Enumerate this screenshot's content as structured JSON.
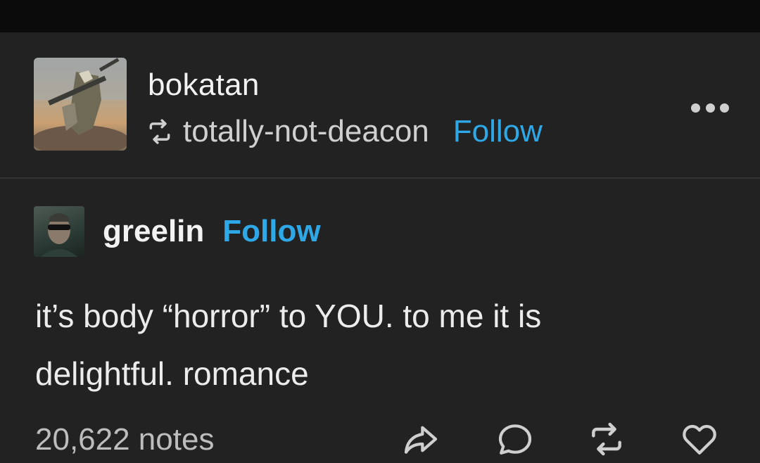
{
  "post": {
    "reblogger": "bokatan",
    "reblogged_from": "totally-not-deacon",
    "reblogged_from_follow": "Follow",
    "original_poster": "greelin",
    "original_poster_follow": "Follow",
    "body_line1": "it’s body “horror” to YOU. to me it is",
    "body_line2": "delightful. romance",
    "notes": "20,622 notes"
  },
  "icons": {
    "reblog_small": "reblog-icon",
    "more": "more-options-icon",
    "share": "share-icon",
    "reply": "reply-icon",
    "reblog": "reblog-icon",
    "like": "heart-icon"
  },
  "colors": {
    "background": "#222222",
    "topbar": "#0b0b0b",
    "accent_link": "#2fa8e8",
    "text": "#f2f2f2"
  }
}
